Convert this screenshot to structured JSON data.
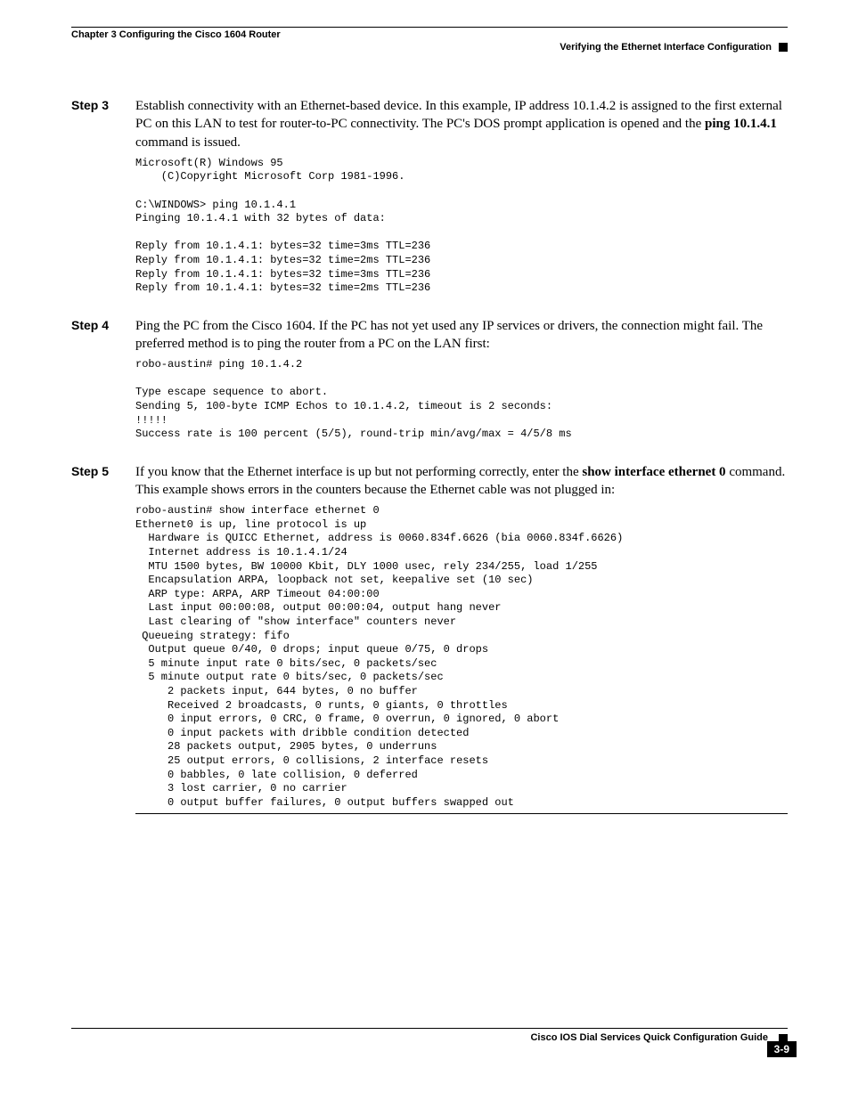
{
  "header": {
    "chapter": "Chapter 3      Configuring the Cisco 1604 Router",
    "section": "Verifying the Ethernet Interface Configuration"
  },
  "steps": {
    "s3": {
      "label": "Step 3",
      "para_before": "Establish connectivity with an Ethernet-based device. In this example, IP address 10.1.4.2 is assigned to the first external PC on this LAN to test for router-to-PC connectivity. The PC's DOS prompt application is opened and the ",
      "bold1": "ping 10.1.4.1",
      "para_after": " command is issued.",
      "code": {
        "l1": "Microsoft(R) Windows 95",
        "l2": "    (C)Copyright Microsoft Corp 1981-1996.",
        "l3": "",
        "l4a": "C:\\WINDOWS> ",
        "l4b": "ping 10.1.4.1",
        "l5": "Pinging 10.1.4.1 with 32 bytes of data:",
        "l6": "",
        "l7": "Reply from 10.1.4.1: bytes=32 time=3ms TTL=236",
        "l8": "Reply from 10.1.4.1: bytes=32 time=2ms TTL=236",
        "l9": "Reply from 10.1.4.1: bytes=32 time=3ms TTL=236",
        "l10": "Reply from 10.1.4.1: bytes=32 time=2ms TTL=236"
      }
    },
    "s4": {
      "label": "Step 4",
      "para": "Ping the PC from the Cisco 1604. If the PC has not yet used any IP services or drivers, the connection might fail. The preferred method is to ping the router from a PC on the LAN first:",
      "code": {
        "l1a": "robo-austin# ",
        "l1b": "ping 10.1.4.2",
        "l2": "",
        "l3": "Type escape sequence to abort.",
        "l4": "Sending 5, 100-byte ICMP Echos to 10.1.4.2, timeout is 2 seconds:",
        "l5": "!!!!!",
        "l6": "Success rate is 100 percent (5/5), round-trip min/avg/max = 4/5/8 ms"
      }
    },
    "s5": {
      "label": "Step 5",
      "para_before": "If you know that the Ethernet interface is up but not performing correctly, enter the ",
      "bold1": "show interface ethernet 0",
      "para_after": " command. This example shows errors in the counters because the Ethernet cable was not plugged in:",
      "code": {
        "l1a": "robo-austin# ",
        "l1b": "show interface ethernet 0",
        "l2": "Ethernet0 is up, line protocol is up",
        "l3": "  Hardware is QUICC Ethernet, address is 0060.834f.6626 (bia 0060.834f.6626)",
        "l4": "  Internet address is 10.1.4.1/24",
        "l5a": "  MTU 1500 bytes, BW 10000 Kbit, DLY 1000 usec, rely 234/255, ",
        "l5b": "load 1/255",
        "l6": "  Encapsulation ARPA, loopback not set, keepalive set (10 sec)",
        "l7": "  ARP type: ARPA, ARP Timeout 04:00:00",
        "l8": "  Last input 00:00:08, output 00:00:04, output hang never",
        "l9": "  Last clearing of \"show interface\" counters never",
        "l10": " Queueing strategy: fifo",
        "l11": "  Output queue 0/40, 0 drops; input queue 0/75, 0 drops",
        "l12": "  5 minute input rate 0 bits/sec, 0 packets/sec",
        "l13": "  5 minute output rate 0 bits/sec, 0 packets/sec",
        "l14": "     2 packets input, 644 bytes, 0 no buffer",
        "l15": "     Received 2 broadcasts, 0 runts, 0 giants, 0 throttles",
        "l16": "     0 input errors, 0 CRC, 0 frame, 0 overrun, 0 ignored, 0 abort",
        "l17": "     0 input packets with dribble condition detected",
        "l18": "     28 packets output, 2905 bytes, 0 underruns",
        "l19a": "     ",
        "l19b": "25 output errors,",
        "l19c": " 0 collisions, 2 interface resets",
        "l20": "     0 babbles, 0 late collision, 0 deferred",
        "l21a": "     ",
        "l21b": "3 lost carrier",
        "l21c": ", 0 no carrier",
        "l22": "     0 output buffer failures, 0 output buffers swapped out"
      }
    }
  },
  "footer": {
    "guide": "Cisco IOS Dial Services Quick Configuration Guide",
    "page": "3-9"
  }
}
